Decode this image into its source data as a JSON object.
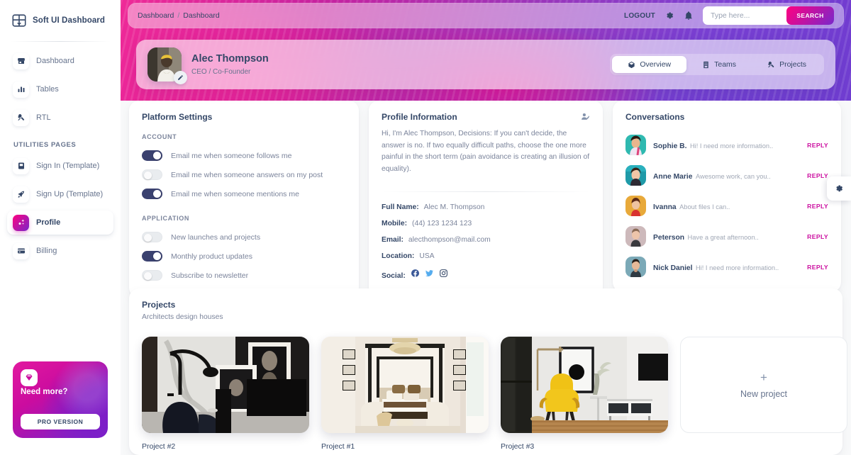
{
  "brand": {
    "name": "Soft UI Dashboard",
    "logo_icon": "soft-ui-logo-icon"
  },
  "sidebar": {
    "items": [
      {
        "label": "Dashboard",
        "icon": "store-icon",
        "active": false
      },
      {
        "label": "Tables",
        "icon": "bar-chart-icon",
        "active": false
      },
      {
        "label": "RTL",
        "icon": "tools-icon",
        "active": false
      }
    ],
    "section_label": "UTILITIES PAGES",
    "utility_items": [
      {
        "label": "Sign In (Template)",
        "icon": "document-icon",
        "active": false
      },
      {
        "label": "Sign Up (Template)",
        "icon": "rocket-icon",
        "active": false
      },
      {
        "label": "Profile",
        "icon": "profile-spark-icon",
        "active": true
      },
      {
        "label": "Billing",
        "icon": "credit-card-icon",
        "active": false
      }
    ],
    "promo": {
      "badge_icon": "diamond-icon",
      "title": "Need more?",
      "button_label": "PRO VERSION"
    }
  },
  "topbar": {
    "breadcrumb": {
      "parent": "Dashboard",
      "separator": "/",
      "current": "Dashboard"
    },
    "logout_label": "LOGOUT",
    "gear_icon": "gear-icon",
    "bell_icon": "bell-icon",
    "search": {
      "placeholder": "Type here...",
      "value": "",
      "button_label": "SEARCH"
    }
  },
  "profile_header": {
    "avatar_icon": "user-avatar",
    "edit_icon": "pencil-icon",
    "name": "Alec Thompson",
    "role": "CEO / Co-Founder",
    "tabs": [
      {
        "label": "Overview",
        "icon": "cube-icon",
        "active": true
      },
      {
        "label": "Teams",
        "icon": "office-icon",
        "active": false
      },
      {
        "label": "Projects",
        "icon": "tools-icon",
        "active": false
      }
    ]
  },
  "platform_settings": {
    "title": "Platform Settings",
    "account_label": "ACCOUNT",
    "account_items": [
      {
        "label": "Email me when someone follows me",
        "on": true
      },
      {
        "label": "Email me when someone answers on my post",
        "on": false
      },
      {
        "label": "Email me when someone mentions me",
        "on": true
      }
    ],
    "application_label": "APPLICATION",
    "application_items": [
      {
        "label": "New launches and projects",
        "on": false
      },
      {
        "label": "Monthly product updates",
        "on": true
      },
      {
        "label": "Subscribe to newsletter",
        "on": false
      }
    ]
  },
  "profile_information": {
    "title": "Profile Information",
    "edit_icon": "edit-user-icon",
    "description": "Hi, I'm Alec Thompson, Decisions: If you can't decide, the answer is no. If two equally difficult paths, choose the one more painful in the short term (pain avoidance is creating an illusion of equality).",
    "fields": [
      {
        "key": "Full Name:",
        "value": "Alec M. Thompson"
      },
      {
        "key": "Mobile:",
        "value": "(44) 123 1234 123"
      },
      {
        "key": "Email:",
        "value": "alecthompson@mail.com"
      },
      {
        "key": "Location:",
        "value": "USA"
      }
    ],
    "social_label": "Social:",
    "socials": [
      {
        "icon": "facebook-icon",
        "color": "#3b5998"
      },
      {
        "icon": "twitter-icon",
        "color": "#55acee"
      },
      {
        "icon": "instagram-icon",
        "color": "#344767"
      }
    ]
  },
  "conversations": {
    "title": "Conversations",
    "reply_label": "REPLY",
    "items": [
      {
        "name": "Sophie B.",
        "message": "Hi! I need more information..",
        "avatar_icon": "avatar-sophie",
        "bg": "#2fb9b0"
      },
      {
        "name": "Anne Marie",
        "message": "Awesome work, can you..",
        "avatar_icon": "avatar-anne",
        "bg": "#1f9aa8"
      },
      {
        "name": "Ivanna",
        "message": "About files I can..",
        "avatar_icon": "avatar-ivanna",
        "bg": "#e8a93a"
      },
      {
        "name": "Peterson",
        "message": "Have a great afternoon..",
        "avatar_icon": "avatar-peterson",
        "bg": "#cdb9bb"
      },
      {
        "name": "Nick Daniel",
        "message": "Hi! I need more information..",
        "avatar_icon": "avatar-nick",
        "bg": "#7ba9b7"
      }
    ]
  },
  "projects": {
    "title": "Projects",
    "subtitle": "Architects design houses",
    "items": [
      {
        "name": "Project #2",
        "thumb_icon": "interior-marble-chair"
      },
      {
        "name": "Project #1",
        "thumb_icon": "interior-canopy-bed"
      },
      {
        "name": "Project #3",
        "thumb_icon": "interior-yellow-chair"
      }
    ],
    "new_project": {
      "plus": "+",
      "label": "New project"
    }
  },
  "floating": {
    "settings_icon": "gear-icon"
  },
  "colors": {
    "accent_pink": "#cb0c9f",
    "accent_purple": "#7928ca",
    "text_dark": "#344767",
    "text_muted": "#7b849b",
    "switch_on": "#3a416f"
  }
}
